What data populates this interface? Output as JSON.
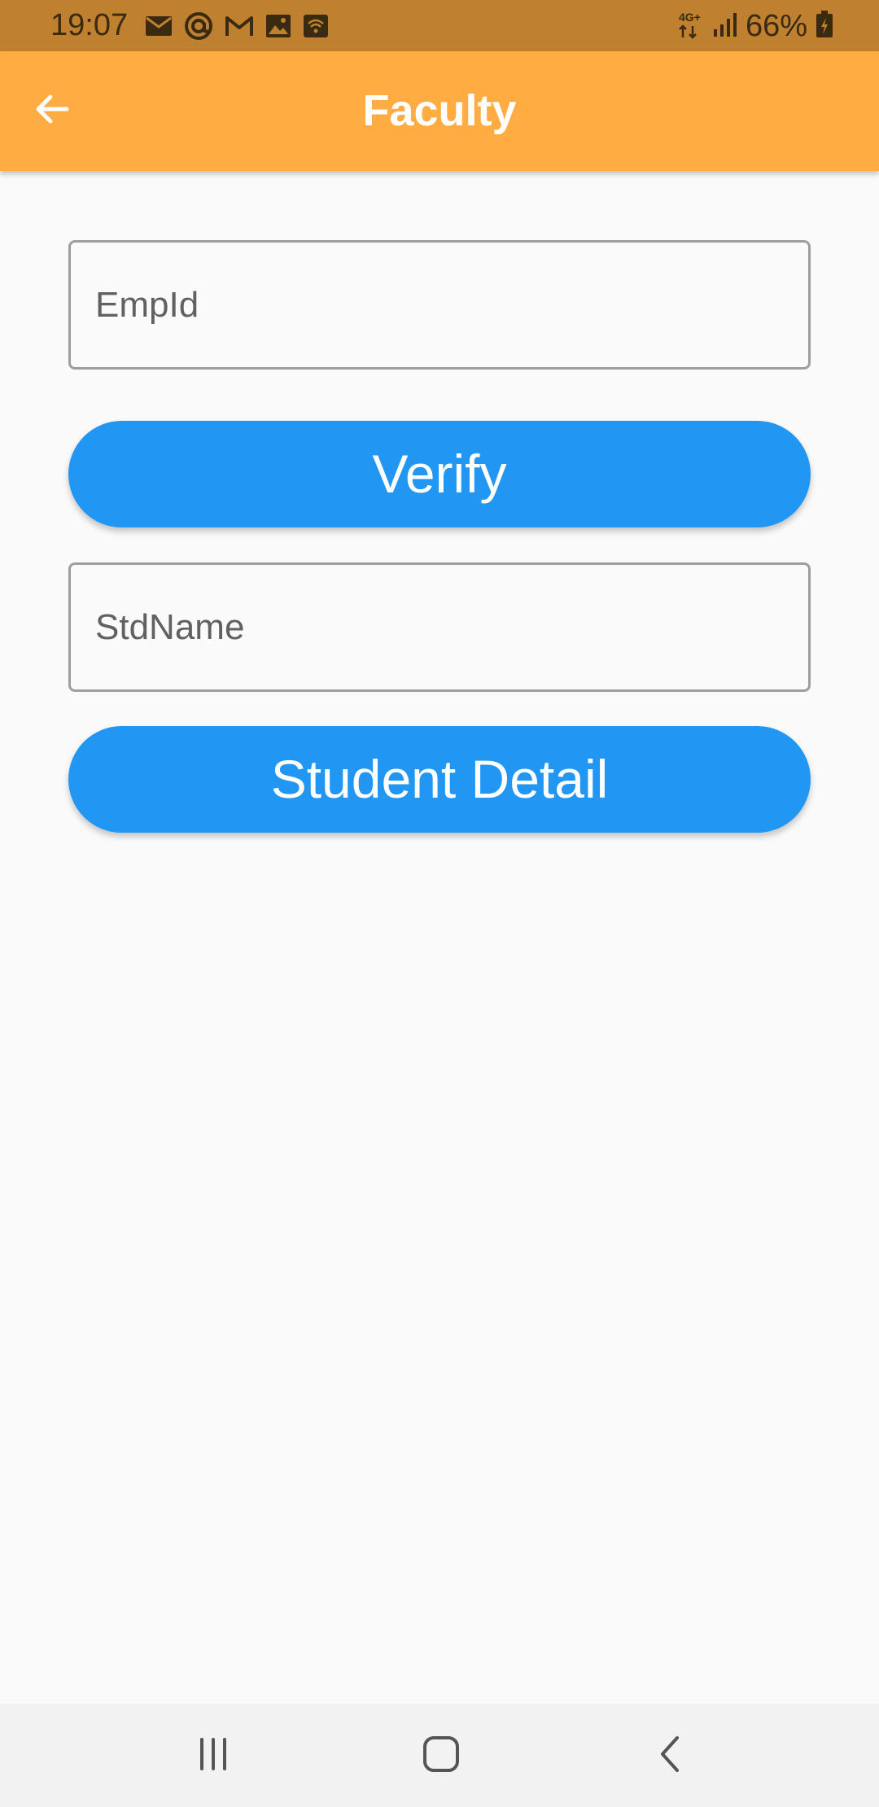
{
  "status_bar": {
    "time": "19:07",
    "network": "4G+",
    "battery_percent": "66%",
    "icons_left": [
      "email-icon",
      "at-sign-icon",
      "gmail-icon",
      "gallery-icon",
      "wifi-call-icon"
    ],
    "icons_right": [
      "mobile-data-icon",
      "signal-icon",
      "battery-charging-icon"
    ],
    "background_color": "#bf8030"
  },
  "app_bar": {
    "title": "Faculty",
    "back_icon": "back-arrow-icon",
    "background_color": "#ffac43"
  },
  "form": {
    "empid_field": {
      "placeholder": "EmpId",
      "value": ""
    },
    "verify_button": {
      "label": "Verify"
    },
    "stdname_field": {
      "placeholder": "StdName",
      "value": ""
    },
    "student_detail_button": {
      "label": "Student Detail"
    },
    "button_color": "#2196f3"
  },
  "nav_bar": {
    "buttons": [
      "recent-apps-icon",
      "home-icon",
      "back-icon"
    ]
  }
}
